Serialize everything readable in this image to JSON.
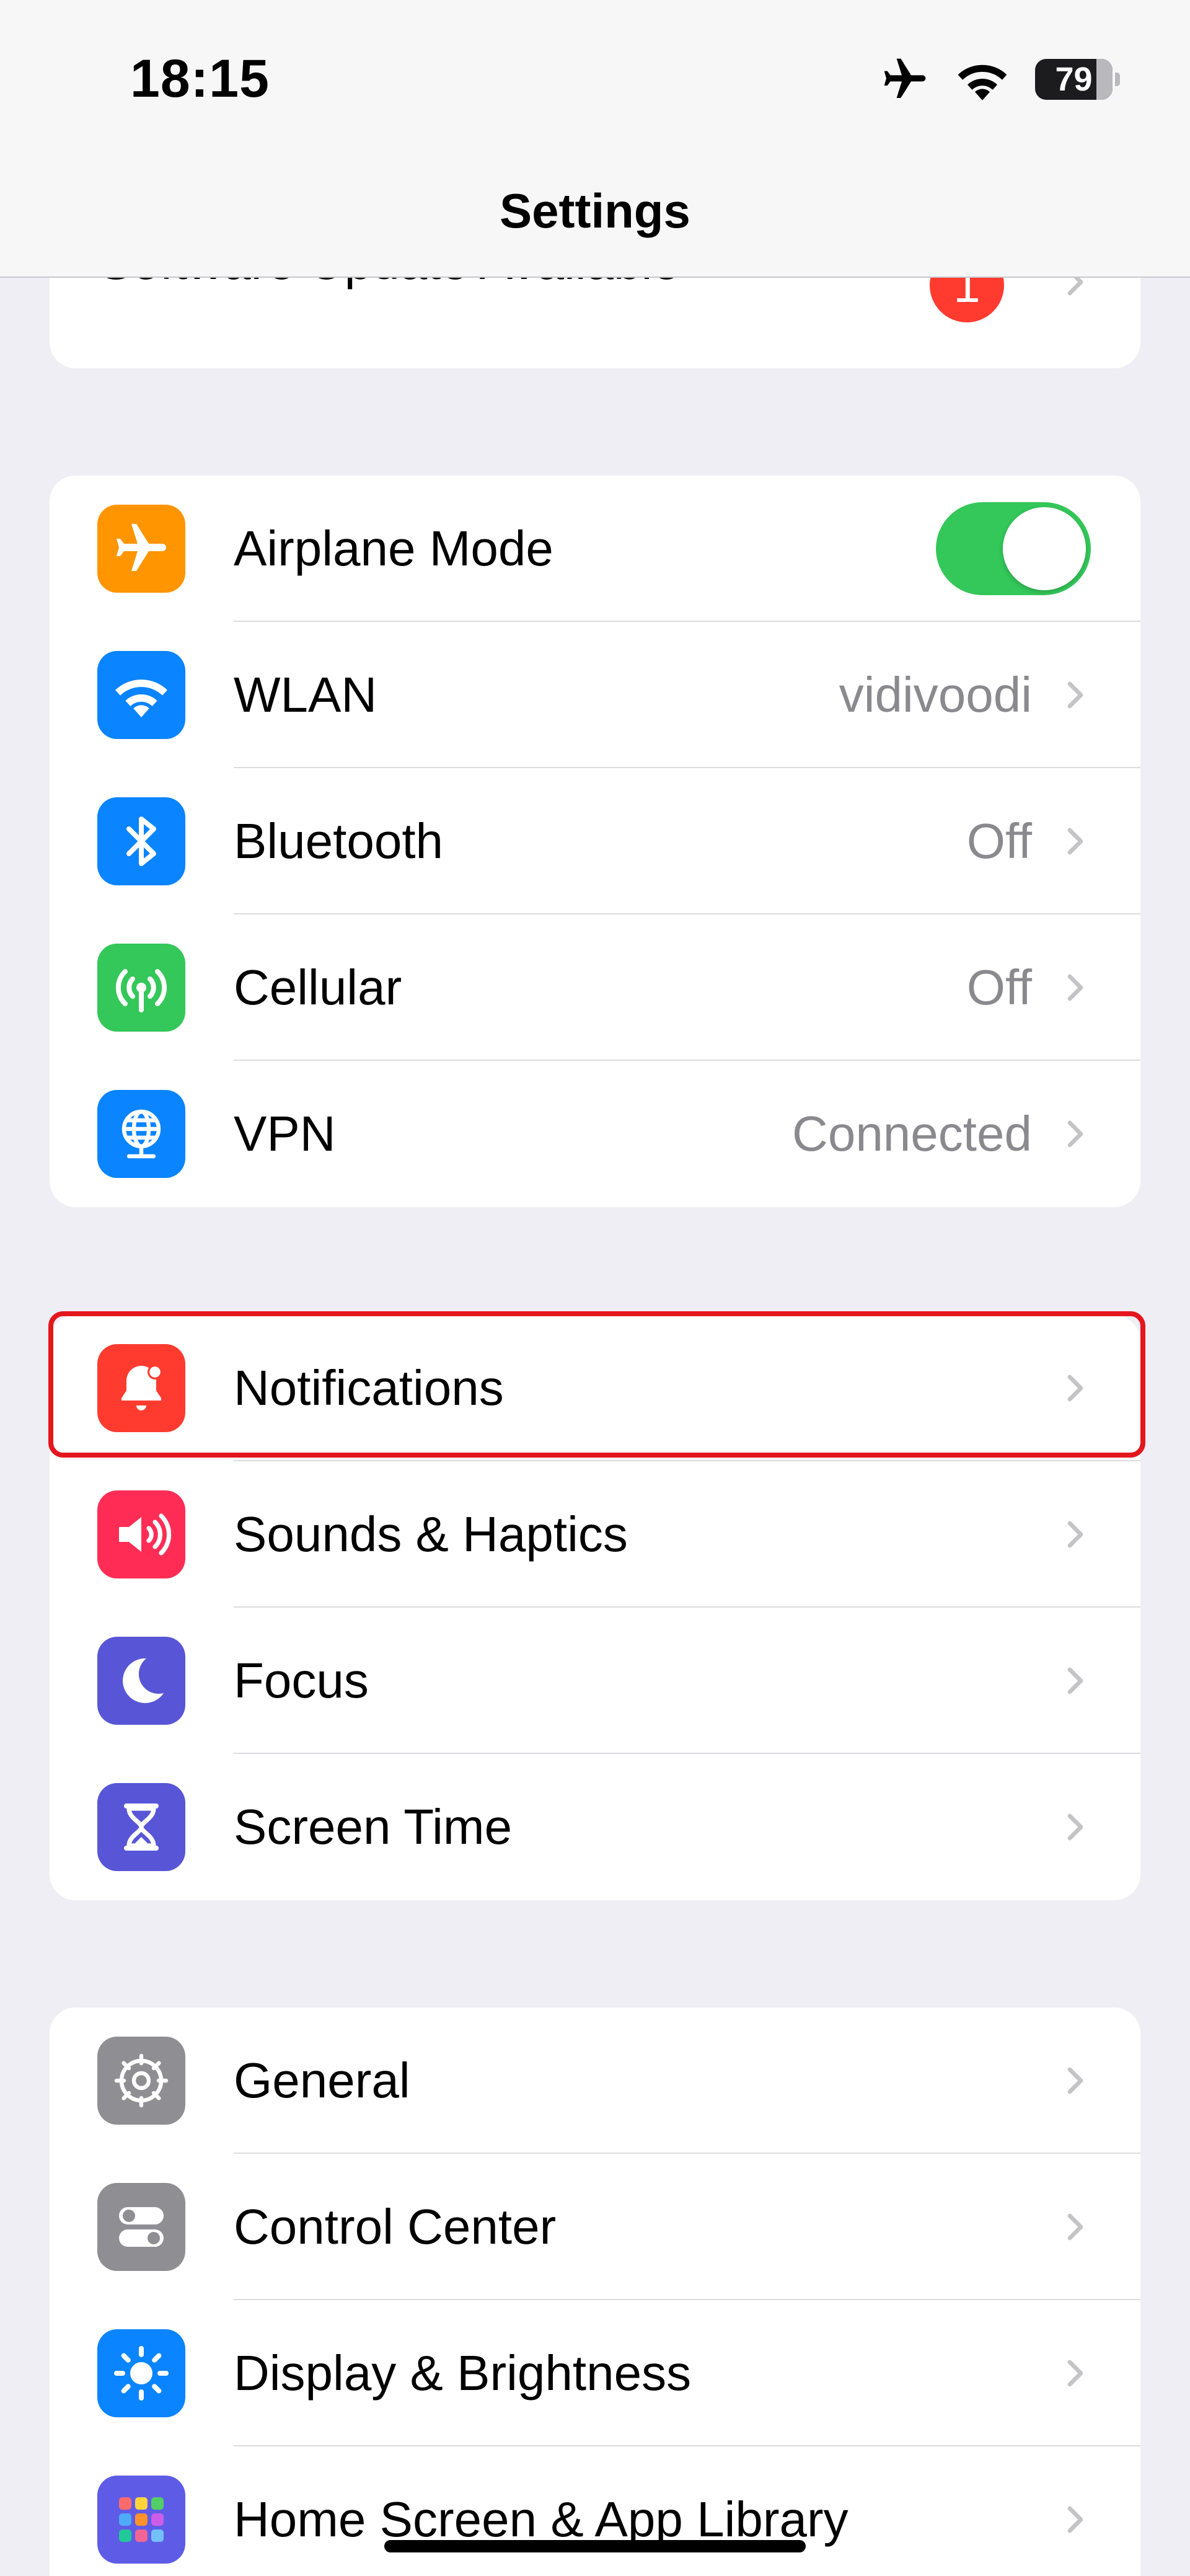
{
  "status_bar": {
    "time": "18:15",
    "battery": "79"
  },
  "nav": {
    "title": "Settings"
  },
  "software_update": {
    "label": "Software Update Available",
    "badge": "1"
  },
  "connectivity": [
    {
      "label": "Airplane Mode",
      "icon": "airplane-icon",
      "color": "#ff9500",
      "toggle_on": true
    },
    {
      "label": "WLAN",
      "value": "vidivoodi",
      "icon": "wifi-icon",
      "color": "#0a84ff"
    },
    {
      "label": "Bluetooth",
      "value": "Off",
      "icon": "bluetooth-icon",
      "color": "#0a84ff"
    },
    {
      "label": "Cellular",
      "value": "Off",
      "icon": "antenna-icon",
      "color": "#34c759"
    },
    {
      "label": "VPN",
      "value": "Connected",
      "icon": "globe-icon",
      "color": "#0a84ff"
    }
  ],
  "attention": [
    {
      "label": "Notifications",
      "icon": "bell-icon",
      "color": "#ff3b30",
      "highlighted": true
    },
    {
      "label": "Sounds & Haptics",
      "icon": "speaker-icon",
      "color": "#ff2d55"
    },
    {
      "label": "Focus",
      "icon": "moon-icon",
      "color": "#5856d6"
    },
    {
      "label": "Screen Time",
      "icon": "hourglass-icon",
      "color": "#5856d6"
    }
  ],
  "system": [
    {
      "label": "General",
      "icon": "gear-icon",
      "color": "#8e8e93"
    },
    {
      "label": "Control Center",
      "icon": "switches-icon",
      "color": "#8e8e93"
    },
    {
      "label": "Display & Brightness",
      "icon": "sun-icon",
      "color": "#0a84ff"
    },
    {
      "label": "Home Screen & App Library",
      "icon": "app-grid-icon",
      "color": "#5e5ce6"
    }
  ]
}
